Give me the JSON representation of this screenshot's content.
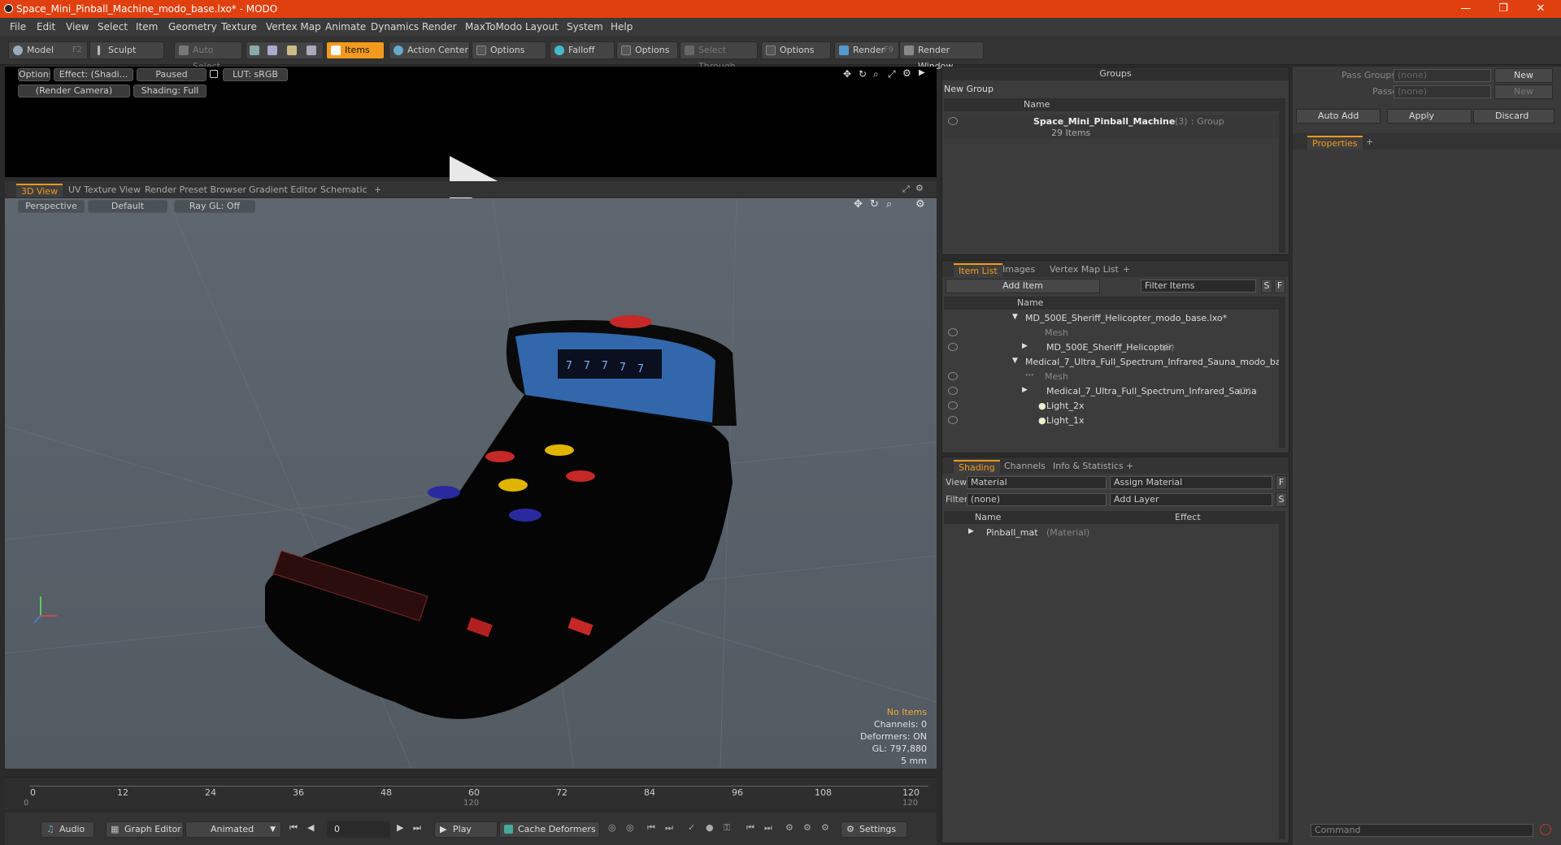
{
  "window": {
    "title": "Space_Mini_Pinball_Machine_modo_base.lxo* - MODO",
    "minimize": "—",
    "restore": "❐",
    "close": "✕"
  },
  "menu": [
    "File",
    "Edit",
    "View",
    "Select",
    "Item",
    "Geometry",
    "Texture",
    "Vertex Map",
    "Animate",
    "Dynamics",
    "Render",
    "MaxToModo",
    "Layout",
    "System",
    "Help"
  ],
  "toolbar": {
    "model": "Model",
    "model_key": "F2",
    "sculpt": "Sculpt",
    "auto_select": "Auto Select",
    "items": "Items",
    "action_center": "Action Center",
    "options1": "Options",
    "falloff": "Falloff",
    "options2": "Options",
    "select_through": "Select Through",
    "options3": "Options",
    "render": "Render",
    "render_key": "F9",
    "render_window": "Render Window"
  },
  "preview": {
    "options": "Options",
    "effect": "Effect: (Shadi...",
    "paused": "Paused",
    "lut": "LUT: sRGB",
    "camera": "(Render Camera)",
    "shading": "Shading: Full"
  },
  "viewport_tabs": [
    "3D View",
    "UV Texture View",
    "Render Preset Browser",
    "Gradient Editor",
    "Schematic",
    "+"
  ],
  "viewport": {
    "perspective": "Perspective",
    "default": "Default",
    "raygl": "Ray GL: Off",
    "hud": {
      "no_items": "No Items",
      "channels": "Channels: 0",
      "deformers": "Deformers: ON",
      "gl": "GL: 797,880",
      "scale": "5 mm"
    },
    "scene_digits": [
      "7",
      "7",
      "7",
      "7",
      "7"
    ],
    "colors": {
      "bumper_red": "#c62828",
      "bumper_yellow": "#e0b400",
      "bumper_blue": "#2a2aa0",
      "backglass": "#3a78c8"
    }
  },
  "timeline": {
    "ticks": [
      "0",
      "12",
      "24",
      "36",
      "48",
      "60",
      "72",
      "84",
      "96",
      "108",
      "120"
    ],
    "lower": [
      "0",
      "120",
      "120"
    ]
  },
  "bottom": {
    "audio": "Audio",
    "graph_editor": "Graph Editor",
    "animated": "Animated",
    "frame": "0",
    "play": "Play",
    "cache": "Cache Deformers",
    "settings": "Settings"
  },
  "groups": {
    "title": "Groups",
    "new_group": "New Group",
    "col_name": "Name",
    "item_name": "Space_Mini_Pinball_Machine",
    "item_count": "(3)",
    "item_type": ": Group",
    "item_sub": "29 Items"
  },
  "item_list": {
    "tabs": [
      "Item List",
      "Images",
      "Vertex Map List",
      "+"
    ],
    "add_item": "Add Item",
    "filter": "Filter Items",
    "s": "S",
    "f": "F",
    "col_name": "Name",
    "rows": [
      {
        "label": "MD_500E_Sheriff_Helicopter_modo_base.lxo*",
        "extra": "",
        "dim": false
      },
      {
        "label": "Mesh",
        "extra": "",
        "dim": true
      },
      {
        "label": "MD_500E_Sheriff_Helicopter",
        "extra": "(2)",
        "dim": false
      },
      {
        "label": "Medical_7_Ultra_Full_Spectrum_Infrared_Sauna_modo_ba ...",
        "extra": "",
        "dim": false
      },
      {
        "label": "Mesh",
        "extra": "",
        "dim": true
      },
      {
        "label": "Medical_7_Ultra_Full_Spectrum_Infrared_Sauna",
        "extra": "(2)",
        "dim": false
      },
      {
        "label": "Light_2x",
        "extra": "",
        "dim": false
      },
      {
        "label": "Light_1x",
        "extra": "",
        "dim": false
      }
    ]
  },
  "shading": {
    "tabs": [
      "Shading",
      "Channels",
      "Info & Statistics",
      "+"
    ],
    "view_label": "View",
    "view_value": "Material",
    "assign": "Assign Material",
    "filter_label": "Filter",
    "filter_value": "(none)",
    "add_layer": "Add Layer",
    "f": "F",
    "s": "S",
    "col_name": "Name",
    "col_effect": "Effect",
    "item": "Pinball_mat",
    "item_type": "(Material)"
  },
  "props": {
    "pass_groups": "Pass Groups",
    "pass_groups_value": "(none)",
    "new1": "New",
    "passes": "Passes",
    "passes_value": "(none)",
    "new2": "New",
    "auto_add": "Auto Add",
    "apply": "Apply",
    "discard": "Discard",
    "tab": "Properties",
    "plus": "+",
    "command": "Command"
  }
}
